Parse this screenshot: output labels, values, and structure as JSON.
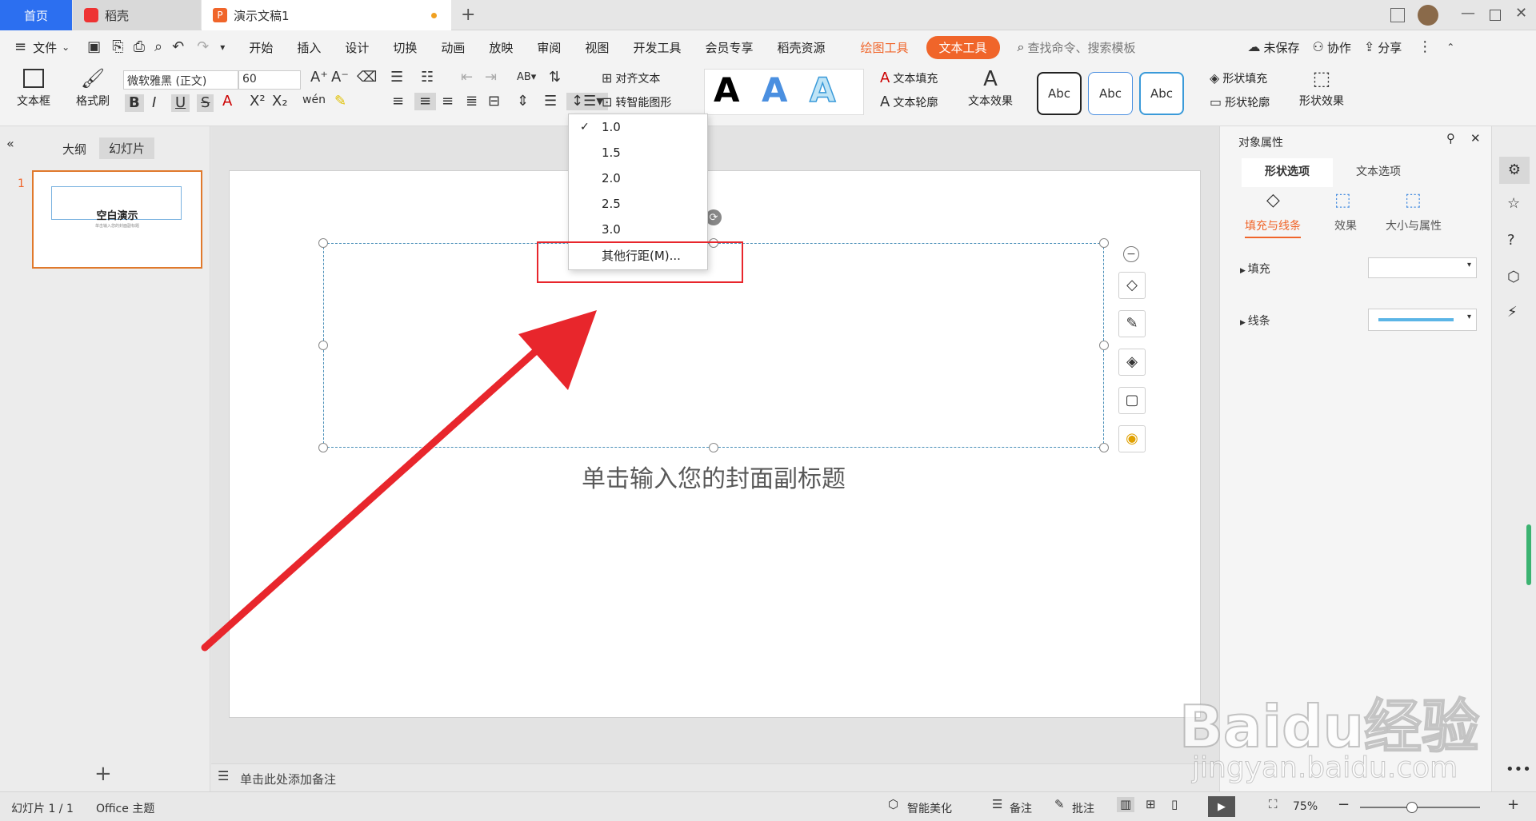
{
  "tabs": {
    "home": "首页",
    "daoke": "稻壳",
    "doc": "演示文稿1"
  },
  "menu": {
    "file": "文件",
    "items": [
      "开始",
      "插入",
      "设计",
      "切换",
      "动画",
      "放映",
      "审阅",
      "视图",
      "开发工具",
      "会员专享",
      "稻壳资源"
    ],
    "drawing_tools": "绘图工具",
    "text_tools": "文本工具",
    "search_placeholder": "查找命令、搜索模板",
    "unsaved": "未保存",
    "collaborate": "协作",
    "share": "分享"
  },
  "ribbon": {
    "textbox": "文本框",
    "format_painter": "格式刷",
    "font_name": "微软雅黑 (正文)",
    "font_size": "60",
    "align_text": "对齐文本",
    "smart_shape": "转智能图形",
    "text_fill": "文本填充",
    "text_outline": "文本轮廓",
    "text_effect": "文本效果",
    "style_abc": "Abc",
    "shape_fill": "形状填充",
    "shape_outline": "形状轮廓",
    "shape_effect": "形状效果"
  },
  "line_spacing_menu": {
    "options": [
      "1.0",
      "1.5",
      "2.0",
      "2.5",
      "3.0"
    ],
    "selected": "1.0",
    "more": "其他行距(M)..."
  },
  "left_panel": {
    "outline_tab": "大纲",
    "slides_tab": "幻灯片",
    "slide_number": "1",
    "thumb_title": "空白演示",
    "thumb_subtitle": "单击输入您的封面副标题"
  },
  "slide": {
    "subtitle_placeholder": "单击输入您的封面副标题"
  },
  "notes": {
    "placeholder": "单击此处添加备注"
  },
  "right_panel": {
    "title": "对象属性",
    "tab_shape": "形状选项",
    "tab_text": "文本选项",
    "sub_fill_line": "填充与线条",
    "sub_effect": "效果",
    "sub_size": "大小与属性",
    "fill": "填充",
    "line": "线条"
  },
  "status": {
    "slide_counter": "幻灯片 1 / 1",
    "theme": "Office 主题",
    "beautify": "智能美化",
    "notes": "备注",
    "comments": "批注",
    "zoom": "75%"
  },
  "watermark": {
    "logo": "Baidu经验",
    "url": "jingyan.baidu.com"
  },
  "colors": {
    "accent_blue": "#2c6ff0",
    "text_tool_orange": "#f0652a",
    "highlight_red": "#e8262c",
    "line_blue": "#5bb5e6"
  }
}
